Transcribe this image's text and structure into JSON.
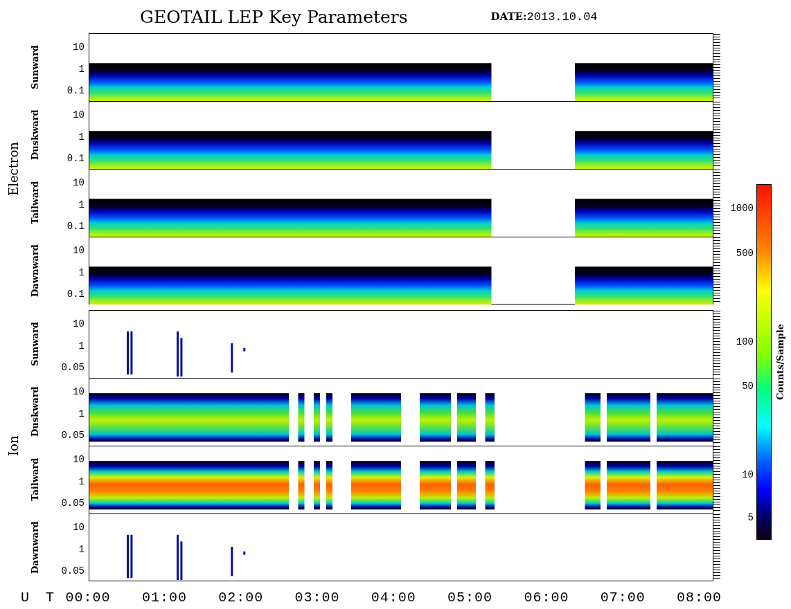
{
  "title": "GEOTAIL LEP Key Parameters",
  "date": "**DATE:**2013.10.04",
  "groups": [
    {
      "label": "Electron",
      "panels": [
        {
          "label": "Sunward",
          "kind": "electron",
          "yticks": [
            "10",
            "1",
            "0.1"
          ]
        },
        {
          "label": "Duskward",
          "kind": "electron",
          "yticks": [
            "10",
            "1",
            "0.1"
          ]
        },
        {
          "label": "Tailward",
          "kind": "electron",
          "yticks": [
            "10",
            "1",
            "0.1"
          ]
        },
        {
          "label": "Dawnward",
          "kind": "electron",
          "yticks": [
            "10",
            "1",
            "0.1"
          ]
        }
      ]
    },
    {
      "label": "Ion",
      "panels": [
        {
          "label": "Sunward",
          "kind": "ion-sparse",
          "yticks": [
            "10",
            "1",
            "0.05"
          ]
        },
        {
          "label": "Duskward",
          "kind": "ion-band",
          "yticks": [
            "10",
            "1",
            "0.05"
          ]
        },
        {
          "label": "Tailward",
          "kind": "ion-hot",
          "yticks": [
            "10",
            "1",
            "0.05"
          ]
        },
        {
          "label": "Dawnward",
          "kind": "ion-sparse",
          "yticks": [
            "10",
            "1",
            "0.05"
          ]
        }
      ]
    }
  ],
  "x_axis": {
    "label": "U T",
    "ticks": [
      "00:00",
      "01:00",
      "02:00",
      "03:00",
      "04:00",
      "05:00",
      "06:00",
      "07:00",
      "08:00"
    ]
  },
  "colorbar": {
    "label": "Counts/Sample",
    "ticks": [
      "1000",
      "500",
      "100",
      "50",
      "10",
      "5"
    ]
  }
}
